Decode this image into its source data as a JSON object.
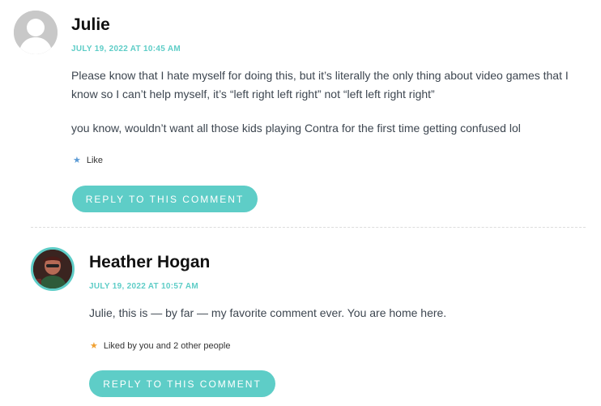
{
  "comments": [
    {
      "author": "Julie",
      "date": "JULY 19, 2022 AT 10:45 AM",
      "paragraphs": [
        "Please know that I hate myself for doing this, but it’s literally the only thing about video games that I know so I can’t help myself, it’s “left right left right” not “left left right right”",
        "you know, wouldn’t want all those kids playing Contra for the first time getting confused lol"
      ],
      "like_text": "Like",
      "reply_label": "REPLY TO THIS COMMENT"
    },
    {
      "author": "Heather Hogan",
      "date": "JULY 19, 2022 AT 10:57 AM",
      "paragraphs": [
        "Julie, this is — by far — my favorite comment ever. You are home here."
      ],
      "like_text": "Liked by you and 2 other people",
      "reply_label": "REPLY TO THIS COMMENT"
    }
  ],
  "colors": {
    "accent": "#5ecdc7",
    "like_star": "#5b9bd5",
    "liked_star": "#f0a030"
  },
  "icons": {
    "avatar_default": "default-avatar-icon",
    "like": "star-icon"
  }
}
